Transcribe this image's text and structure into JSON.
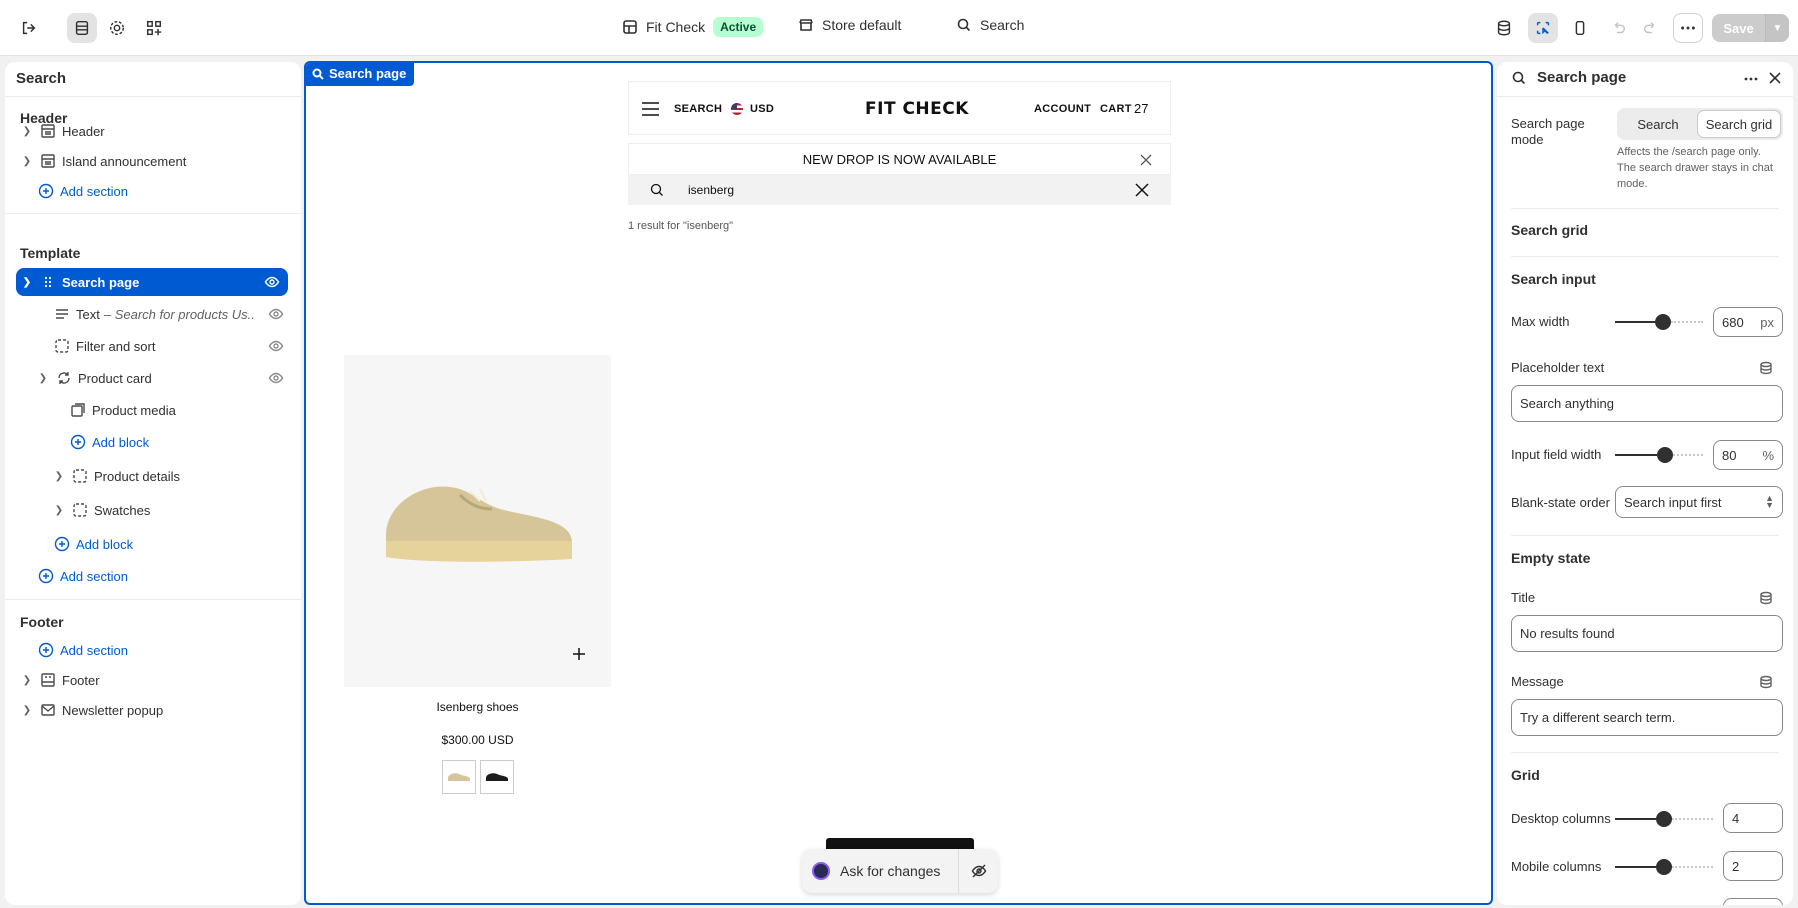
{
  "topbar": {
    "store_name": "Fit Check",
    "store_status": "Active",
    "context": "Store default",
    "search": "Search",
    "save_label": "Save"
  },
  "left_panel": {
    "title": "Search",
    "header_group": "Header",
    "header_items": [
      "Header",
      "Island announcement"
    ],
    "add_section": "Add section",
    "template_group": "Template",
    "selected_item": "Search page",
    "text_block_label": "Text",
    "text_block_preview": "Search for products Us...",
    "filter_sort": "Filter and sort",
    "product_card": "Product card",
    "product_media": "Product media",
    "add_block": "Add block",
    "product_details": "Product details",
    "swatches": "Swatches",
    "footer_group": "Footer",
    "footer_items": [
      "Footer",
      "Newsletter popup"
    ]
  },
  "canvas": {
    "tag": "Search page",
    "nav_search": "SEARCH",
    "currency": "USD",
    "logo": "FIT CHECK",
    "account": "ACCOUNT",
    "cart": "CART",
    "cart_count": "27",
    "announcement": "NEW DROP IS NOW AVAILABLE",
    "search_value": "isenberg",
    "results_count": "1 result for \"isenberg\"",
    "product_title": "Isenberg shoes",
    "product_price": "$300.00 USD",
    "ask_label": "Ask for changes"
  },
  "right_panel": {
    "title": "Search page",
    "mode_label": "Search page mode",
    "mode_options": [
      "Search",
      "Search grid"
    ],
    "mode_selected": "Search grid",
    "mode_help": "Affects the /search page only. The search drawer stays in chat mode.",
    "search_grid_heading": "Search grid",
    "search_input_heading": "Search input",
    "max_width_label": "Max width",
    "max_width_value": "680",
    "max_width_unit": "px",
    "max_width_fill": 0.55,
    "placeholder_label": "Placeholder text",
    "placeholder_value": "Search anything",
    "input_width_label": "Input field width",
    "input_width_value": "80",
    "input_width_unit": "%",
    "input_width_fill": 0.58,
    "blank_order_label": "Blank-state order",
    "blank_order_value": "Search input first",
    "empty_state_heading": "Empty state",
    "title_label": "Title",
    "title_value": "No results found",
    "message_label": "Message",
    "message_value": "Try a different search term.",
    "grid_heading": "Grid",
    "desktop_cols_label": "Desktop columns",
    "desktop_cols_value": "4",
    "desktop_cols_fill": 0.5,
    "mobile_cols_label": "Mobile columns",
    "mobile_cols_value": "2",
    "mobile_cols_fill": 0.5
  }
}
